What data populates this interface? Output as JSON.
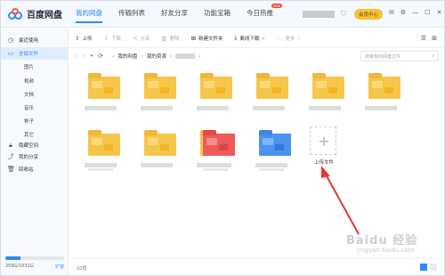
{
  "app": {
    "title": "百度网盘"
  },
  "nav": {
    "tabs": [
      {
        "label": "我的网盘",
        "active": true
      },
      {
        "label": "传输列表"
      },
      {
        "label": "好友分享"
      },
      {
        "label": "功能宝箱"
      },
      {
        "label": "今日热推",
        "badge": "new"
      }
    ]
  },
  "header": {
    "vip_label": "会员中心"
  },
  "sidebar": {
    "items": [
      {
        "label": "最近使用",
        "icon": "clock-icon"
      },
      {
        "label": "全部文件",
        "icon": "folder-icon",
        "active": true
      }
    ],
    "sub_items": [
      "图片",
      "视频",
      "文档",
      "音乐",
      "种子",
      "其它"
    ],
    "bottom_items": [
      {
        "label": "隐藏空间",
        "icon": "lock-icon"
      },
      {
        "label": "我的分享",
        "icon": "share-icon"
      },
      {
        "label": "回收站",
        "icon": "trash-icon"
      }
    ],
    "storage_text": "259G/1031G",
    "storage_fraction": 0.25,
    "expand_label": "扩容"
  },
  "toolbar": {
    "upload": "上传",
    "download": "下载",
    "share": "分享",
    "delete": "删除",
    "new_folder": "新建文件夹",
    "offline_download": "离线下载",
    "more": "更多"
  },
  "breadcrumb": {
    "items": [
      "我的网盘",
      "我的资源"
    ]
  },
  "search": {
    "placeholder": "搜索我的网盘文件"
  },
  "upload_tile": {
    "label": "上传文件"
  },
  "footer": {
    "item_count": "10项"
  },
  "colors": {
    "accent": "#2f8af5",
    "folder": "#f6c64a",
    "annotation_arrow": "#e53935"
  },
  "watermark": {
    "text": "Baidu 经验",
    "sub": "jingyan.baidu.com"
  }
}
